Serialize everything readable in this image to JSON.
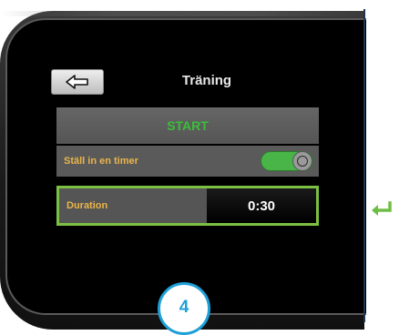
{
  "screen": {
    "title": "Träning",
    "back_icon": "arrow-left-icon",
    "start_label": "START",
    "timer_label": "Ställ in en timer",
    "timer_enabled": true,
    "duration_label": "Duration",
    "duration_value": "0:30"
  },
  "step": {
    "number": "4"
  },
  "colors": {
    "start_text": "#38c038",
    "row_label": "#e9b54a",
    "highlight_border": "#7cc043",
    "toggle_on": "#49b548",
    "badge": "#1ea0d8",
    "enter_arrow": "#6fbe44"
  },
  "icons": {
    "side_arrow": "enter-return-icon"
  }
}
